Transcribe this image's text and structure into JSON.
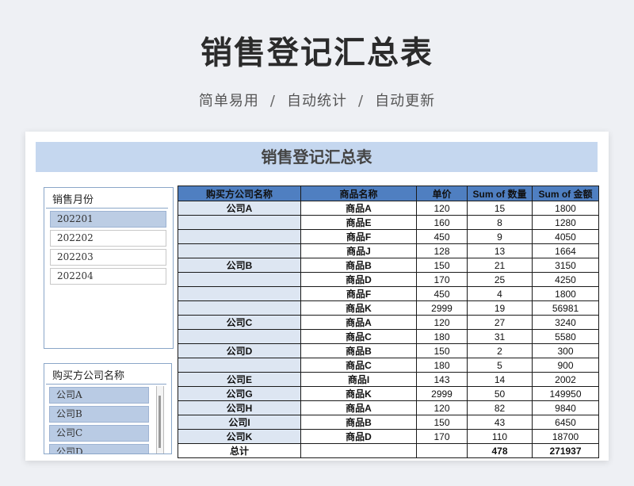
{
  "page": {
    "title": "销售登记汇总表",
    "subtitle": [
      "简单易用",
      "自动统计",
      "自动更新"
    ],
    "separator": "/"
  },
  "sheet": {
    "title": "销售登记汇总表"
  },
  "slicer_month": {
    "header": "销售月份",
    "items": [
      {
        "label": "202201",
        "selected": true
      },
      {
        "label": "202202",
        "selected": false
      },
      {
        "label": "202203",
        "selected": false
      },
      {
        "label": "202204",
        "selected": false
      }
    ]
  },
  "slicer_company": {
    "header": "购买方公司名称",
    "items": [
      "公司A",
      "公司B",
      "公司C",
      "公司D"
    ]
  },
  "table": {
    "headers": [
      "购买方公司名称",
      "商品名称",
      "单价",
      "Sum of 数量",
      "Sum of 金额"
    ],
    "rows": [
      [
        "公司A",
        "商品A",
        "120",
        "15",
        "1800"
      ],
      [
        "",
        "商品E",
        "160",
        "8",
        "1280"
      ],
      [
        "",
        "商品F",
        "450",
        "9",
        "4050"
      ],
      [
        "",
        "商品J",
        "128",
        "13",
        "1664"
      ],
      [
        "公司B",
        "商品B",
        "150",
        "21",
        "3150"
      ],
      [
        "",
        "商品D",
        "170",
        "25",
        "4250"
      ],
      [
        "",
        "商品F",
        "450",
        "4",
        "1800"
      ],
      [
        "",
        "商品K",
        "2999",
        "19",
        "56981"
      ],
      [
        "公司C",
        "商品A",
        "120",
        "27",
        "3240"
      ],
      [
        "",
        "商品C",
        "180",
        "31",
        "5580"
      ],
      [
        "公司D",
        "商品B",
        "150",
        "2",
        "300"
      ],
      [
        "",
        "商品C",
        "180",
        "5",
        "900"
      ],
      [
        "公司E",
        "商品I",
        "143",
        "14",
        "2002"
      ],
      [
        "公司G",
        "商品K",
        "2999",
        "50",
        "149950"
      ],
      [
        "公司H",
        "商品A",
        "120",
        "82",
        "9840"
      ],
      [
        "公司I",
        "商品B",
        "150",
        "43",
        "6450"
      ],
      [
        "公司K",
        "商品D",
        "170",
        "110",
        "18700"
      ]
    ],
    "total_row": [
      "总计",
      "",
      "",
      "478",
      "271937"
    ]
  },
  "colors": {
    "header_bg": "#4f7fc1",
    "title_band": "#c5d7ef",
    "company_cell": "#dde6f2",
    "slicer_selected": "#bccde4"
  }
}
